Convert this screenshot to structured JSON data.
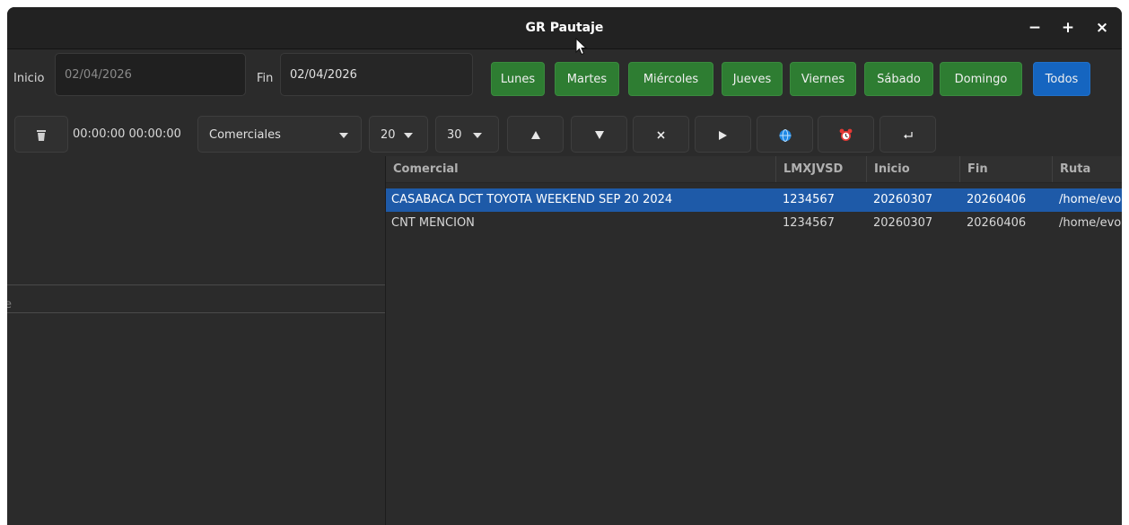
{
  "window": {
    "title": "GR Pautaje",
    "minimize": "−",
    "maximize": "+",
    "close": "×"
  },
  "filters": {
    "inicio_label": "Inicio",
    "inicio_value": "02/04/2026",
    "fin_label": "Fin",
    "fin_value": "02/04/2026"
  },
  "days": [
    "Lunes",
    "Martes",
    "Miércoles",
    "Jueves",
    "Viernes",
    "Sábado",
    "Domingo"
  ],
  "todos_label": "Todos",
  "toolbar": {
    "time_range": "00:00:00 00:00:00",
    "category": "Comerciales",
    "count_a": "20",
    "count_b": "30"
  },
  "table": {
    "headers": [
      "Comercial",
      "LMXJVSD",
      "Inicio",
      "Fin",
      "Ruta"
    ],
    "rows": [
      {
        "comercial": "CASABACA DCT TOYOTA WEEKEND SEP 20 2024",
        "dias": "1234567",
        "inicio": "20260307",
        "fin": "20260406",
        "ruta": "/home/evo",
        "selected": true
      },
      {
        "comercial": "CNT MENCION",
        "dias": "1234567",
        "inicio": "20260307",
        "fin": "20260406",
        "ruta": "/home/evo",
        "selected": false
      }
    ]
  },
  "left_panel": {
    "partial_header": "e"
  },
  "colors": {
    "day_button": "#2e7d32",
    "todos_button": "#1565c0",
    "selection": "#1e5aa8",
    "alarm_icon": "#e53935",
    "globe_icon": "#1e88e5"
  }
}
